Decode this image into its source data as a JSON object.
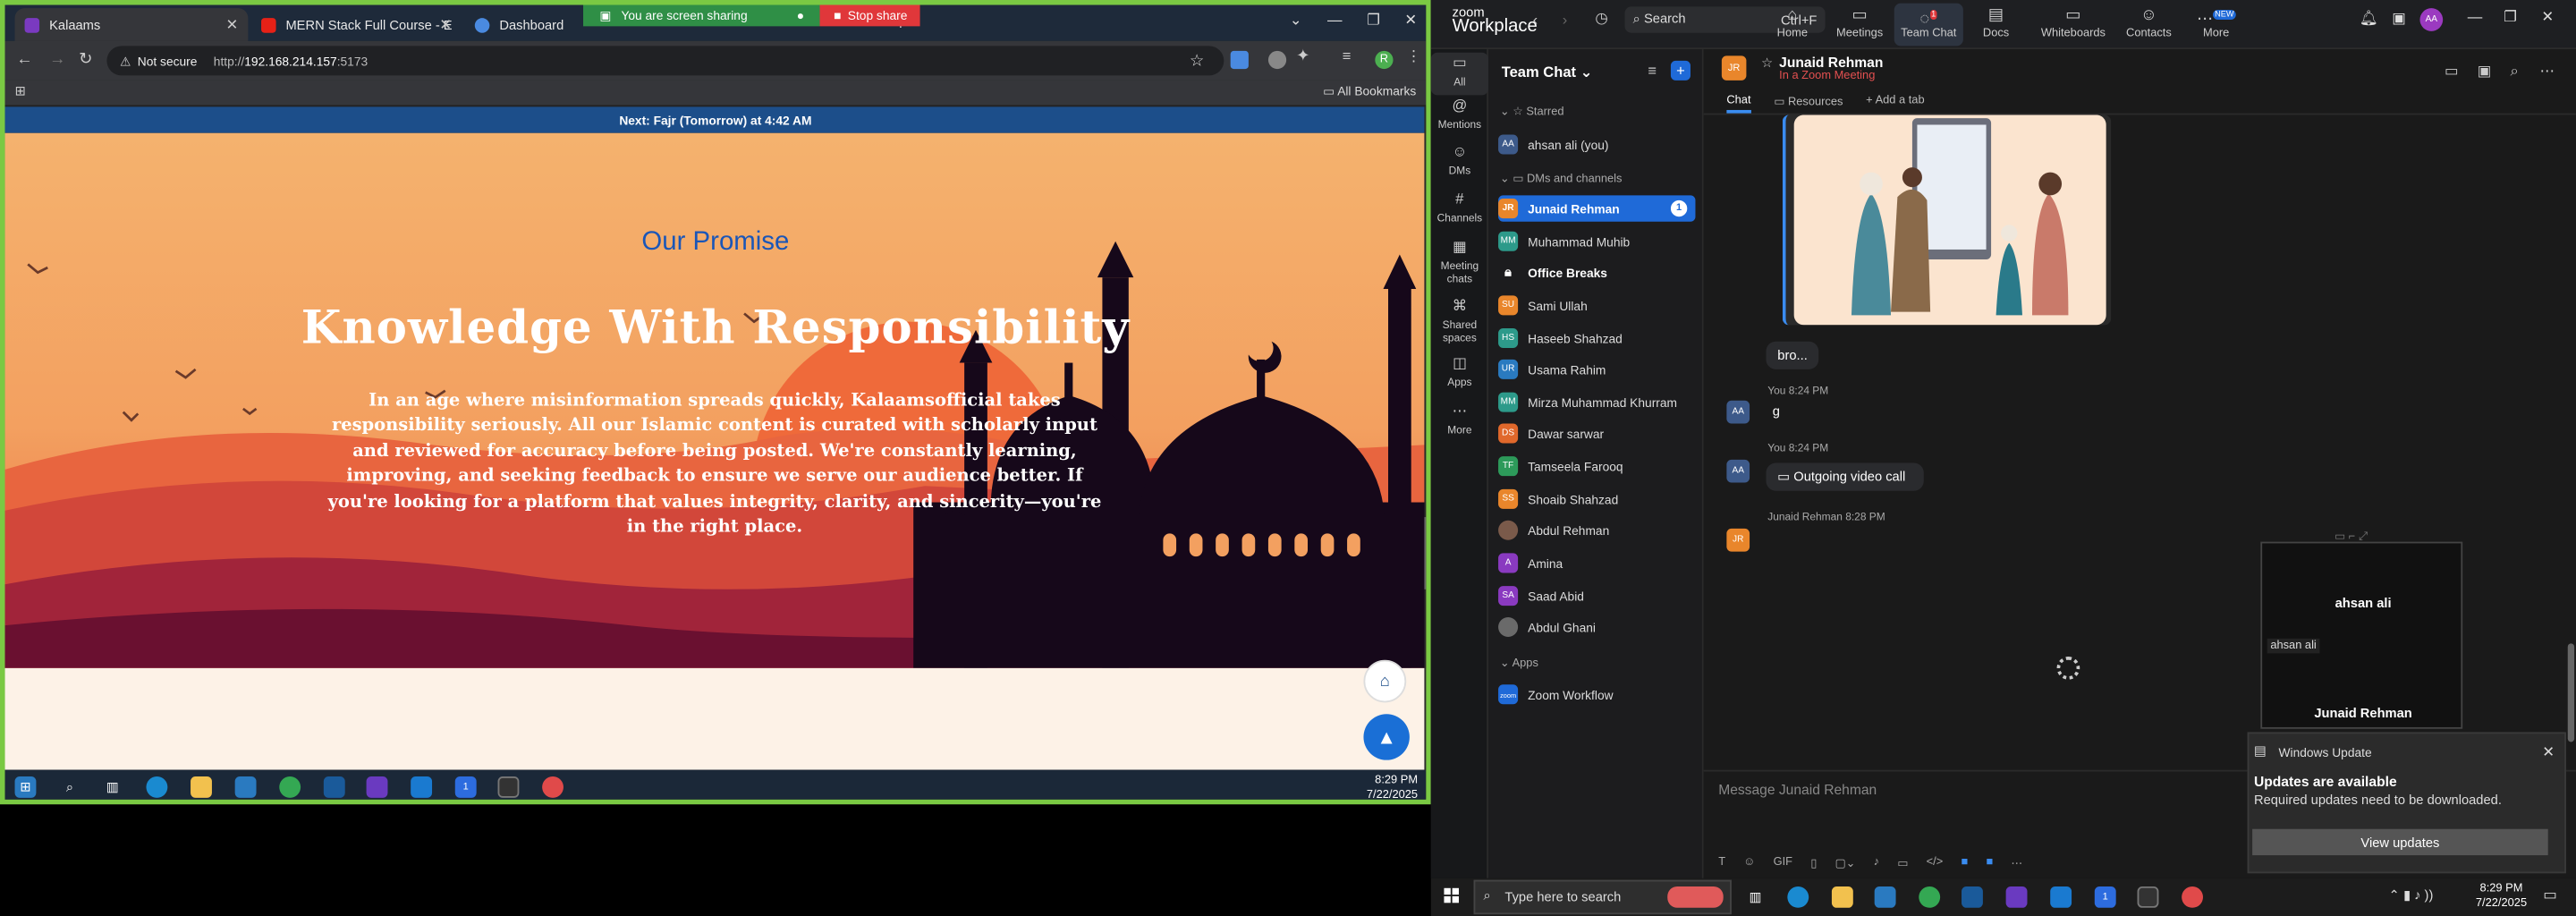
{
  "browser": {
    "tabs": [
      {
        "label": "Kalaams"
      },
      {
        "label": "MERN Stack Full Course - ECom"
      },
      {
        "label": "Dashboard"
      }
    ],
    "share": {
      "sharing_label": "You are screen sharing",
      "stop_label": "Stop share"
    },
    "address": {
      "not_secure": "Not secure",
      "host": "192.168.214.157",
      "port": ":5173",
      "scheme": "http://"
    },
    "bookmarks": {
      "all_label": "All Bookmarks"
    },
    "avatar_letter": "R"
  },
  "page": {
    "prayer_prefix": "Next: ",
    "prayer_name": "Fajr (Tomorrow)",
    "prayer_time": " at 4:42 AM",
    "section_label": "Our Promise",
    "heading": "Knowledge With Responsibility",
    "paragraph": "In an age where misinformation spreads quickly, Kalaamsofficial takes responsibility seriously. All our Islamic content is curated with scholarly input and reviewed for accuracy before being posted. We're constantly learning, improving, and seeking feedback to ensure we serve our audience better. If you're looking for a platform that values integrity, clarity, and sincerity—you're in the right place."
  },
  "left_taskbar": {
    "time": "8:29 PM",
    "date": "7/22/2025",
    "zoom_badge": "1"
  },
  "zoom": {
    "logo_top": "zoom",
    "logo_bottom": "Workplace",
    "search_label": "Search",
    "search_shortcut": "Ctrl+F",
    "nav": [
      {
        "label": "Home",
        "icon": "home-icon"
      },
      {
        "label": "Meetings",
        "icon": "video-icon"
      },
      {
        "label": "Team Chat",
        "icon": "chat-icon",
        "badge": "1"
      },
      {
        "label": "Docs",
        "icon": "doc-icon"
      },
      {
        "label": "Whiteboards",
        "icon": "whiteboard-icon"
      },
      {
        "label": "Contacts",
        "icon": "contacts-icon"
      },
      {
        "label": "More",
        "icon": "more-icon",
        "badge": "NEW"
      }
    ],
    "profile_initials": "AA",
    "rail": [
      {
        "label": "All"
      },
      {
        "label": "Mentions"
      },
      {
        "label": "DMs",
        "badge": "1"
      },
      {
        "label": "Channels"
      },
      {
        "label": "Meeting chats"
      },
      {
        "label": "Shared spaces"
      },
      {
        "label": "Apps"
      },
      {
        "label": "More"
      }
    ],
    "list_title": "Team Chat",
    "sections": {
      "starred": "Starred",
      "dms": "DMs and channels",
      "apps": "Apps"
    },
    "starred": [
      {
        "initials": "AA",
        "name": "ahsan ali (you)",
        "color": "#3d5a8a"
      }
    ],
    "contacts": [
      {
        "initials": "JR",
        "name": "Junaid Rehman",
        "color": "#e9862b",
        "badge": "1"
      },
      {
        "initials": "MM",
        "name": "Muhammad Muhib",
        "color": "#2d9a8a"
      },
      {
        "initials": "",
        "name": "Office Breaks",
        "color": "#2b2b2b"
      },
      {
        "initials": "SU",
        "name": "Sami Ullah",
        "color": "#e9862b"
      },
      {
        "initials": "HS",
        "name": "Haseeb Shahzad",
        "color": "#2d9a8a"
      },
      {
        "initials": "UR",
        "name": "Usama Rahim",
        "color": "#2a7ac0"
      },
      {
        "initials": "MM",
        "name": "Mirza Muhammad Khurram",
        "color": "#2d9a8a"
      },
      {
        "initials": "DS",
        "name": "Dawar sarwar",
        "color": "#e0682b"
      },
      {
        "initials": "TF",
        "name": "Tamseela Farooq",
        "color": "#2d9a5a"
      },
      {
        "initials": "SS",
        "name": "Shoaib Shahzad",
        "color": "#e9862b"
      },
      {
        "initials": "",
        "name": "Abdul Rehman",
        "color": "#7a5a4a"
      },
      {
        "initials": "A",
        "name": "Amina",
        "color": "#8a3ac0"
      },
      {
        "initials": "SA",
        "name": "Saad Abid",
        "color": "#8a3ac0"
      },
      {
        "initials": "",
        "name": "Abdul Ghani",
        "color": "#6a6a6a"
      }
    ],
    "apps": [
      {
        "initials": "zoom",
        "name": "Zoom Workflow",
        "color": "#1f6ad8"
      }
    ],
    "chat": {
      "name": "Junaid Rehman",
      "status": "In a Zoom Meeting",
      "tabs": [
        "Chat",
        "Resources",
        "Add a tab"
      ],
      "messages": [
        {
          "text": "bro..."
        },
        {
          "meta": "You 8:24 PM",
          "text": "g"
        },
        {
          "meta": "You 8:24 PM",
          "text": "Outgoing video call"
        },
        {
          "meta": "Junaid Rehman 8:28 PM"
        }
      ],
      "video": {
        "self_name": "ahsan ali",
        "self_label": "ahsan ali",
        "other_name": "Junaid Rehman"
      },
      "composer_placeholder": "Message Junaid Rehman",
      "gif_label": "GIF"
    },
    "windows_update": {
      "app": "Windows Update",
      "title": "Updates are available",
      "body": "Required updates need to be downloaded.",
      "button": "View updates"
    }
  },
  "right_taskbar": {
    "search_placeholder": "Type here to search",
    "time": "8:29 PM",
    "date": "7/22/2025",
    "zoom_badge": "1"
  }
}
